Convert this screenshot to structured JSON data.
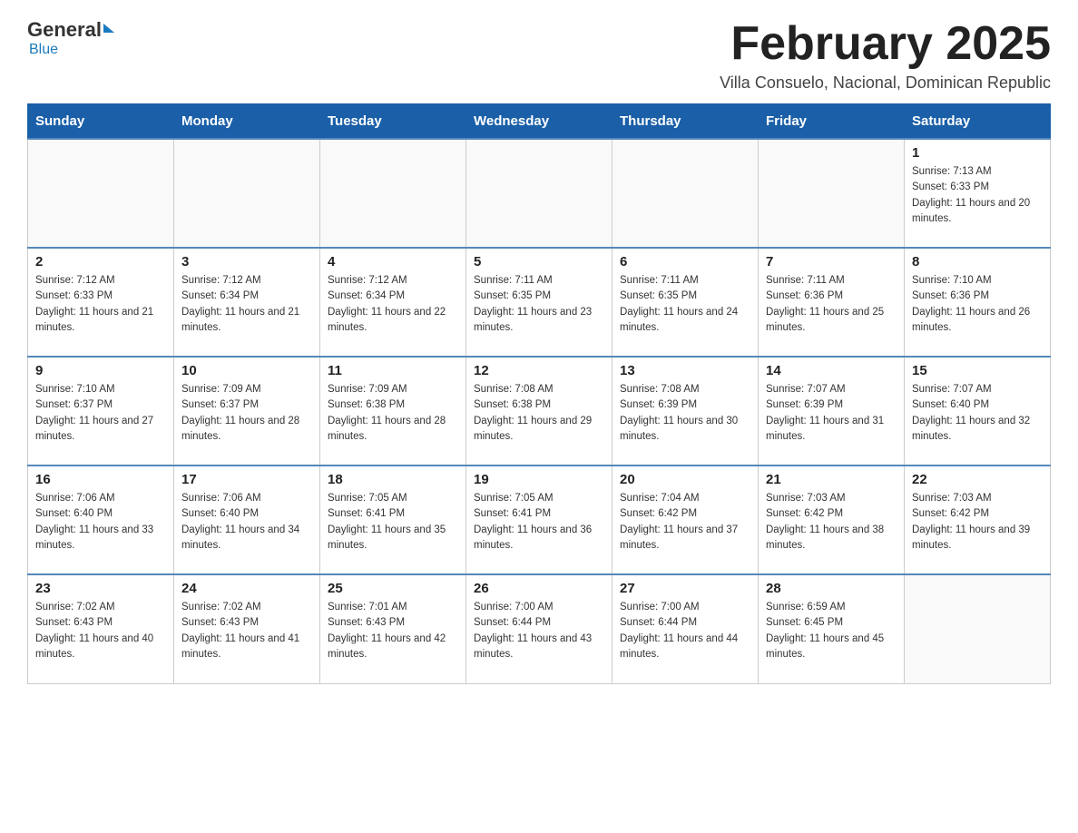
{
  "header": {
    "logo_general": "General",
    "logo_blue": "Blue",
    "main_title": "February 2025",
    "subtitle": "Villa Consuelo, Nacional, Dominican Republic"
  },
  "calendar": {
    "days_of_week": [
      "Sunday",
      "Monday",
      "Tuesday",
      "Wednesday",
      "Thursday",
      "Friday",
      "Saturday"
    ],
    "weeks": [
      [
        {
          "day": "",
          "info": ""
        },
        {
          "day": "",
          "info": ""
        },
        {
          "day": "",
          "info": ""
        },
        {
          "day": "",
          "info": ""
        },
        {
          "day": "",
          "info": ""
        },
        {
          "day": "",
          "info": ""
        },
        {
          "day": "1",
          "info": "Sunrise: 7:13 AM\nSunset: 6:33 PM\nDaylight: 11 hours and 20 minutes."
        }
      ],
      [
        {
          "day": "2",
          "info": "Sunrise: 7:12 AM\nSunset: 6:33 PM\nDaylight: 11 hours and 21 minutes."
        },
        {
          "day": "3",
          "info": "Sunrise: 7:12 AM\nSunset: 6:34 PM\nDaylight: 11 hours and 21 minutes."
        },
        {
          "day": "4",
          "info": "Sunrise: 7:12 AM\nSunset: 6:34 PM\nDaylight: 11 hours and 22 minutes."
        },
        {
          "day": "5",
          "info": "Sunrise: 7:11 AM\nSunset: 6:35 PM\nDaylight: 11 hours and 23 minutes."
        },
        {
          "day": "6",
          "info": "Sunrise: 7:11 AM\nSunset: 6:35 PM\nDaylight: 11 hours and 24 minutes."
        },
        {
          "day": "7",
          "info": "Sunrise: 7:11 AM\nSunset: 6:36 PM\nDaylight: 11 hours and 25 minutes."
        },
        {
          "day": "8",
          "info": "Sunrise: 7:10 AM\nSunset: 6:36 PM\nDaylight: 11 hours and 26 minutes."
        }
      ],
      [
        {
          "day": "9",
          "info": "Sunrise: 7:10 AM\nSunset: 6:37 PM\nDaylight: 11 hours and 27 minutes."
        },
        {
          "day": "10",
          "info": "Sunrise: 7:09 AM\nSunset: 6:37 PM\nDaylight: 11 hours and 28 minutes."
        },
        {
          "day": "11",
          "info": "Sunrise: 7:09 AM\nSunset: 6:38 PM\nDaylight: 11 hours and 28 minutes."
        },
        {
          "day": "12",
          "info": "Sunrise: 7:08 AM\nSunset: 6:38 PM\nDaylight: 11 hours and 29 minutes."
        },
        {
          "day": "13",
          "info": "Sunrise: 7:08 AM\nSunset: 6:39 PM\nDaylight: 11 hours and 30 minutes."
        },
        {
          "day": "14",
          "info": "Sunrise: 7:07 AM\nSunset: 6:39 PM\nDaylight: 11 hours and 31 minutes."
        },
        {
          "day": "15",
          "info": "Sunrise: 7:07 AM\nSunset: 6:40 PM\nDaylight: 11 hours and 32 minutes."
        }
      ],
      [
        {
          "day": "16",
          "info": "Sunrise: 7:06 AM\nSunset: 6:40 PM\nDaylight: 11 hours and 33 minutes."
        },
        {
          "day": "17",
          "info": "Sunrise: 7:06 AM\nSunset: 6:40 PM\nDaylight: 11 hours and 34 minutes."
        },
        {
          "day": "18",
          "info": "Sunrise: 7:05 AM\nSunset: 6:41 PM\nDaylight: 11 hours and 35 minutes."
        },
        {
          "day": "19",
          "info": "Sunrise: 7:05 AM\nSunset: 6:41 PM\nDaylight: 11 hours and 36 minutes."
        },
        {
          "day": "20",
          "info": "Sunrise: 7:04 AM\nSunset: 6:42 PM\nDaylight: 11 hours and 37 minutes."
        },
        {
          "day": "21",
          "info": "Sunrise: 7:03 AM\nSunset: 6:42 PM\nDaylight: 11 hours and 38 minutes."
        },
        {
          "day": "22",
          "info": "Sunrise: 7:03 AM\nSunset: 6:42 PM\nDaylight: 11 hours and 39 minutes."
        }
      ],
      [
        {
          "day": "23",
          "info": "Sunrise: 7:02 AM\nSunset: 6:43 PM\nDaylight: 11 hours and 40 minutes."
        },
        {
          "day": "24",
          "info": "Sunrise: 7:02 AM\nSunset: 6:43 PM\nDaylight: 11 hours and 41 minutes."
        },
        {
          "day": "25",
          "info": "Sunrise: 7:01 AM\nSunset: 6:43 PM\nDaylight: 11 hours and 42 minutes."
        },
        {
          "day": "26",
          "info": "Sunrise: 7:00 AM\nSunset: 6:44 PM\nDaylight: 11 hours and 43 minutes."
        },
        {
          "day": "27",
          "info": "Sunrise: 7:00 AM\nSunset: 6:44 PM\nDaylight: 11 hours and 44 minutes."
        },
        {
          "day": "28",
          "info": "Sunrise: 6:59 AM\nSunset: 6:45 PM\nDaylight: 11 hours and 45 minutes."
        },
        {
          "day": "",
          "info": ""
        }
      ]
    ]
  }
}
